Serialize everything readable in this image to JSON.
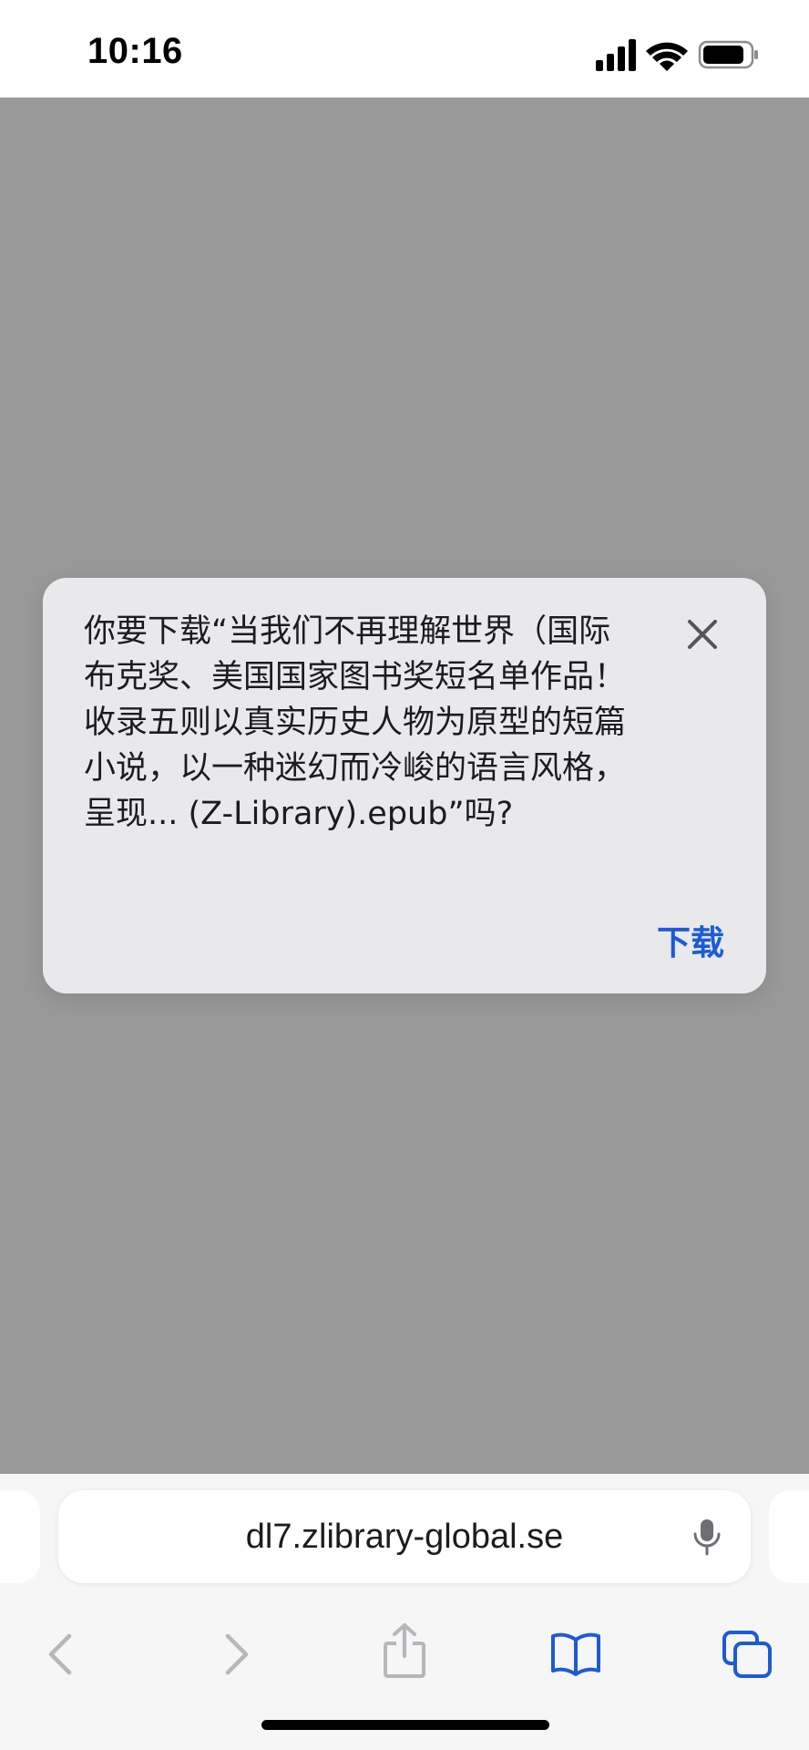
{
  "status_bar": {
    "time": "10:16",
    "signal_icon": "cellular-signal-icon",
    "wifi_icon": "wifi-icon",
    "battery_icon": "battery-icon"
  },
  "dialog": {
    "message": "你要下载“当我们不再理解世界（国际布克奖、美国国家图书奖短名单作品！收录五则以真实历史人物为原型的短篇小说，以一种迷幻而冷峻的语言风格，呈现... (Z-Library).epub”吗?",
    "close_icon": "close-icon",
    "download_label": "下载",
    "accent_color": "#1d5bd6"
  },
  "address_bar": {
    "url": "dl7.zlibrary-global.se",
    "mic_icon": "microphone-icon"
  },
  "toolbar": {
    "back_icon": "chevron-left-icon",
    "forward_icon": "chevron-right-icon",
    "share_icon": "share-icon",
    "bookmarks_icon": "book-icon",
    "tabs_icon": "tabs-icon"
  },
  "colors": {
    "page_background": "#999999",
    "dialog_background": "#e9e9ec",
    "toolbar_background": "#f6f6f6"
  }
}
